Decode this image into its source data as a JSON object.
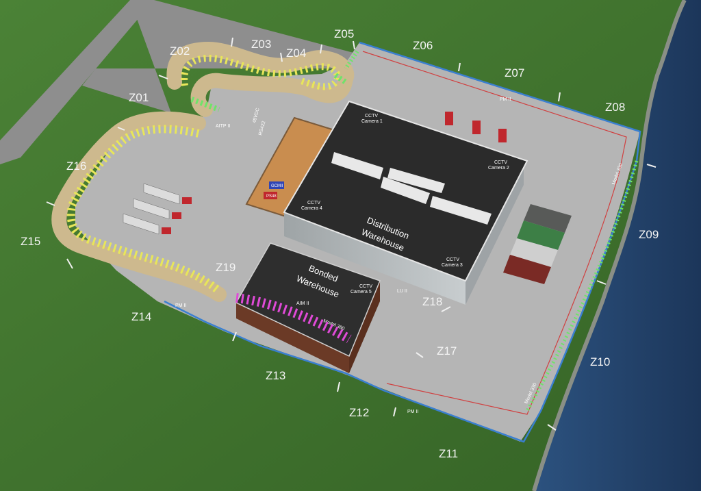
{
  "colors": {
    "grass": "#3f7330",
    "water": "#25456f",
    "road": "#8c8c8c",
    "pavement": "#b7b7b7",
    "roof": "#2a2a2a",
    "fence": "#3a7fd0",
    "cable_red": "#d04040",
    "sensor_yellow": "#e8e65a",
    "sensor_green": "#6fe36a",
    "sensor_magenta": "#e04ad8",
    "bonded_wall": "#6b3a26"
  },
  "zones": [
    "Z01",
    "Z02",
    "Z03",
    "Z04",
    "Z05",
    "Z06",
    "Z07",
    "Z08",
    "Z09",
    "Z10",
    "Z11",
    "Z12",
    "Z13",
    "Z14",
    "Z15",
    "Z16",
    "Z17",
    "Z18",
    "Z19"
  ],
  "distribution_warehouse": {
    "title_line1": "Distribution",
    "title_line2": "Warehouse",
    "cameras": [
      {
        "line1": "CCTV",
        "line2": "Camera 1"
      },
      {
        "line1": "CCTV",
        "line2": "Camera 2"
      },
      {
        "line1": "CCTV",
        "line2": "Camera 3"
      },
      {
        "line1": "CCTV",
        "line2": "Camera 4"
      }
    ]
  },
  "bonded_warehouse": {
    "title_line1": "Bonded",
    "title_line2": "Warehouse",
    "camera": {
      "line1": "CCTV",
      "line2": "Camera 5"
    },
    "sensor_labels": [
      "AIM II",
      "Model 380"
    ]
  },
  "control_room": {
    "panels": [
      "GCMII",
      "PS48"
    ]
  },
  "equipment_labels": {
    "pm_ii": "PM II",
    "lu_ii": "LU II",
    "model_330": "Model 330",
    "rs422": "RS422",
    "48vdc": "48VDC",
    "aitp": "AITP II"
  }
}
